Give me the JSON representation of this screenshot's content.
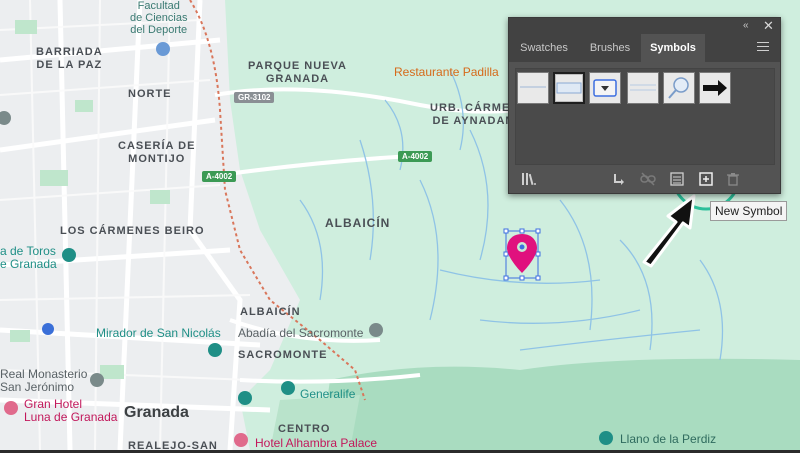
{
  "map": {
    "districts": {
      "barriada_line1": "BARRIADA",
      "barriada_line2": "DE LA PAZ",
      "norte": "NORTE",
      "caseria_line1": "CASERÍA DE",
      "caseria_line2": "MONTIJO",
      "carmenes_beiro": "LOS CÁRMENES BEIRO",
      "parque_line1": "PARQUE NUEVA",
      "parque_line2": "GRANADA",
      "urb_line1": "URB. CÁRMENES",
      "urb_line2": "DE AYNADAMAR",
      "albaicin_big": "ALBAICÍN",
      "albaicin_small": "ALBAICÍN",
      "sacromonte": "SACROMONTE",
      "centro": "CENTRO",
      "realejo": "REALEJO-SAN"
    },
    "pois": {
      "facultad_line1": "Facultad",
      "facultad_line2": "de Ciencias",
      "facultad_line3": "del Deporte",
      "restaurante": "Restaurante Padilla",
      "plaza_line1": "a de Toros",
      "plaza_line2": "e Granada",
      "mirador": "Mirador de San Nicolás",
      "abadia": "Abadía del Sacromonte",
      "monasterio_line1": "Real Monasterio",
      "monasterio_line2": "San Jerónimo",
      "gran_hotel_line1": "Gran Hotel",
      "gran_hotel_line2": "Luna de Granada",
      "generalife": "Generalife",
      "hotel_alhambra": "Hotel Alhambra Palace",
      "llano": "Llano de la Perdiz"
    },
    "city": "Granada",
    "roads": {
      "gr3102": "GR-3102",
      "a4002_a": "A-4002",
      "a4002_b": "A-4002"
    },
    "colors": {
      "urban": "#eceef0",
      "park": "#c9ead6",
      "pin": "#e0117e",
      "highlight_ring": "#2bbf9a"
    }
  },
  "panel": {
    "tabs": [
      "Swatches",
      "Brushes",
      "Symbols"
    ],
    "active_tab": "Symbols",
    "close_glyph": "✕",
    "collapse_glyph": "«",
    "footer_buttons": [
      "symbol-libraries",
      "place-symbol",
      "break-link",
      "symbol-options",
      "new-symbol",
      "delete-symbol"
    ]
  },
  "tooltip": {
    "text": "New Symbol"
  }
}
